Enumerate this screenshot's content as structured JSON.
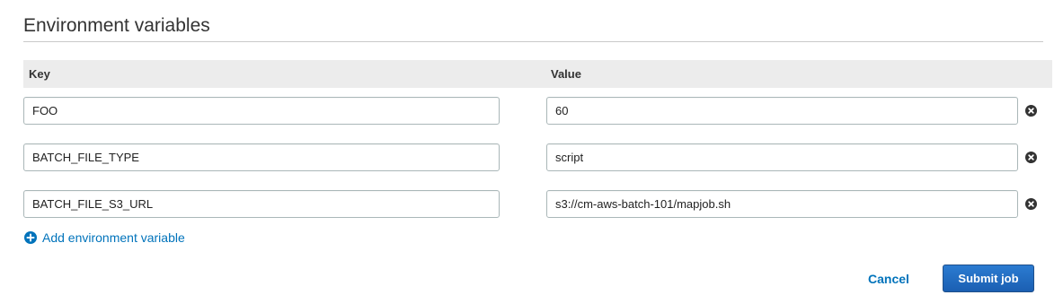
{
  "section": {
    "title": "Environment variables"
  },
  "table": {
    "headers": {
      "key": "Key",
      "value": "Value"
    },
    "rows": [
      {
        "key": "FOO",
        "value": "60"
      },
      {
        "key": "BATCH_FILE_TYPE",
        "value": "script"
      },
      {
        "key": "BATCH_FILE_S3_URL",
        "value": "s3://cm-aws-batch-101/mapjob.sh"
      }
    ]
  },
  "actions": {
    "add_label": "Add environment variable",
    "cancel_label": "Cancel",
    "submit_label": "Submit job"
  },
  "icons": {
    "remove": "remove-circle-icon",
    "add": "add-circle-icon"
  },
  "colors": {
    "link": "#0073bb",
    "primary_button": "#1b5fb2",
    "header_bg": "#ececec"
  }
}
